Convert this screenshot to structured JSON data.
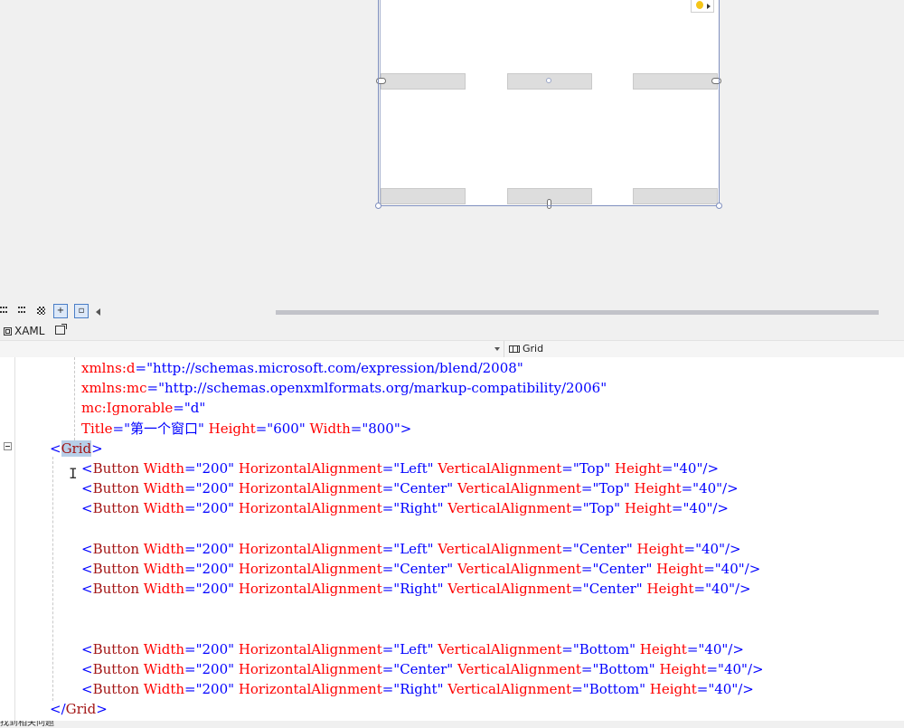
{
  "designer": {
    "bulb_icon": "lightbulb-icon"
  },
  "toolstrip": {
    "icons": [
      "grid-layout-icon",
      "snap-grid-icon",
      "checker-icon",
      "snap-lines-icon",
      "project-code-icon",
      "scroll-left-icon"
    ]
  },
  "tabs": {
    "xaml_label": "XAML"
  },
  "navbar": {
    "element_label": "Grid"
  },
  "editor": {
    "lines": [
      {
        "row": 0,
        "indent": 90,
        "parts": [
          {
            "t": "xmlns:d",
            "c": "att"
          },
          {
            "t": "=\"",
            "c": "br"
          },
          {
            "t": "http://schemas.microsoft.com/expression/blend/2008",
            "c": "val"
          },
          {
            "t": "\"",
            "c": "br"
          }
        ]
      },
      {
        "row": 1,
        "indent": 90,
        "parts": [
          {
            "t": "xmlns:mc",
            "c": "att"
          },
          {
            "t": "=\"",
            "c": "br"
          },
          {
            "t": "http://schemas.openxmlformats.org/markup-compatibility/2006",
            "c": "val"
          },
          {
            "t": "\"",
            "c": "br"
          }
        ]
      },
      {
        "row": 2,
        "indent": 90,
        "parts": [
          {
            "t": "mc:Ignorable",
            "c": "att"
          },
          {
            "t": "=\"",
            "c": "br"
          },
          {
            "t": "d",
            "c": "val"
          },
          {
            "t": "\"",
            "c": "br"
          }
        ]
      },
      {
        "row": 3,
        "indent": 90,
        "parts": [
          {
            "t": "Title",
            "c": "att"
          },
          {
            "t": "=\"",
            "c": "br"
          },
          {
            "t": "第一个窗口",
            "c": "val"
          },
          {
            "t": "\" ",
            "c": "br"
          },
          {
            "t": "Height",
            "c": "att"
          },
          {
            "t": "=\"",
            "c": "br"
          },
          {
            "t": "600",
            "c": "val"
          },
          {
            "t": "\" ",
            "c": "br"
          },
          {
            "t": "Width",
            "c": "att"
          },
          {
            "t": "=\"",
            "c": "br"
          },
          {
            "t": "800",
            "c": "val"
          },
          {
            "t": "\">",
            "c": "br"
          }
        ]
      },
      {
        "row": 4,
        "indent": 55,
        "parts": [
          {
            "t": "<",
            "c": "br"
          },
          {
            "t": "Grid",
            "c": "tag sel"
          },
          {
            "t": ">",
            "c": "br"
          }
        ]
      },
      {
        "row": 5,
        "indent": 90,
        "parts": [
          {
            "t": "<",
            "c": "br"
          },
          {
            "t": "Button",
            "c": "tag"
          },
          {
            "t": " Width",
            "c": "att"
          },
          {
            "t": "=\"",
            "c": "br"
          },
          {
            "t": "200",
            "c": "val"
          },
          {
            "t": "\" ",
            "c": "br"
          },
          {
            "t": "HorizontalAlignment",
            "c": "att"
          },
          {
            "t": "=\"",
            "c": "br"
          },
          {
            "t": "Left",
            "c": "val"
          },
          {
            "t": "\" ",
            "c": "br"
          },
          {
            "t": "VerticalAlignment",
            "c": "att"
          },
          {
            "t": "=\"",
            "c": "br"
          },
          {
            "t": "Top",
            "c": "val"
          },
          {
            "t": "\" ",
            "c": "br"
          },
          {
            "t": "Height",
            "c": "att"
          },
          {
            "t": "=\"",
            "c": "br"
          },
          {
            "t": "40",
            "c": "val"
          },
          {
            "t": "\"/>",
            "c": "br"
          }
        ]
      },
      {
        "row": 6,
        "indent": 90,
        "parts": [
          {
            "t": "<",
            "c": "br"
          },
          {
            "t": "Button",
            "c": "tag"
          },
          {
            "t": " Width",
            "c": "att"
          },
          {
            "t": "=\"",
            "c": "br"
          },
          {
            "t": "200",
            "c": "val"
          },
          {
            "t": "\" ",
            "c": "br"
          },
          {
            "t": "HorizontalAlignment",
            "c": "att"
          },
          {
            "t": "=\"",
            "c": "br"
          },
          {
            "t": "Center",
            "c": "val"
          },
          {
            "t": "\" ",
            "c": "br"
          },
          {
            "t": "VerticalAlignment",
            "c": "att"
          },
          {
            "t": "=\"",
            "c": "br"
          },
          {
            "t": "Top",
            "c": "val"
          },
          {
            "t": "\" ",
            "c": "br"
          },
          {
            "t": "Height",
            "c": "att"
          },
          {
            "t": "=\"",
            "c": "br"
          },
          {
            "t": "40",
            "c": "val"
          },
          {
            "t": "\"/>",
            "c": "br"
          }
        ]
      },
      {
        "row": 7,
        "indent": 90,
        "parts": [
          {
            "t": "<",
            "c": "br"
          },
          {
            "t": "Button",
            "c": "tag"
          },
          {
            "t": " Width",
            "c": "att"
          },
          {
            "t": "=\"",
            "c": "br"
          },
          {
            "t": "200",
            "c": "val"
          },
          {
            "t": "\" ",
            "c": "br"
          },
          {
            "t": "HorizontalAlignment",
            "c": "att"
          },
          {
            "t": "=\"",
            "c": "br"
          },
          {
            "t": "Right",
            "c": "val"
          },
          {
            "t": "\" ",
            "c": "br"
          },
          {
            "t": "VerticalAlignment",
            "c": "att"
          },
          {
            "t": "=\"",
            "c": "br"
          },
          {
            "t": "Top",
            "c": "val"
          },
          {
            "t": "\" ",
            "c": "br"
          },
          {
            "t": "Height",
            "c": "att"
          },
          {
            "t": "=\"",
            "c": "br"
          },
          {
            "t": "40",
            "c": "val"
          },
          {
            "t": "\"/>",
            "c": "br"
          }
        ]
      },
      {
        "row": 9,
        "indent": 90,
        "parts": [
          {
            "t": "<",
            "c": "br"
          },
          {
            "t": "Button",
            "c": "tag"
          },
          {
            "t": " Width",
            "c": "att"
          },
          {
            "t": "=\"",
            "c": "br"
          },
          {
            "t": "200",
            "c": "val"
          },
          {
            "t": "\" ",
            "c": "br"
          },
          {
            "t": "HorizontalAlignment",
            "c": "att"
          },
          {
            "t": "=\"",
            "c": "br"
          },
          {
            "t": "Left",
            "c": "val"
          },
          {
            "t": "\" ",
            "c": "br"
          },
          {
            "t": "VerticalAlignment",
            "c": "att"
          },
          {
            "t": "=\"",
            "c": "br"
          },
          {
            "t": "Center",
            "c": "val"
          },
          {
            "t": "\" ",
            "c": "br"
          },
          {
            "t": "Height",
            "c": "att"
          },
          {
            "t": "=\"",
            "c": "br"
          },
          {
            "t": "40",
            "c": "val"
          },
          {
            "t": "\"/>",
            "c": "br"
          }
        ]
      },
      {
        "row": 10,
        "indent": 90,
        "parts": [
          {
            "t": "<",
            "c": "br"
          },
          {
            "t": "Button",
            "c": "tag"
          },
          {
            "t": " Width",
            "c": "att"
          },
          {
            "t": "=\"",
            "c": "br"
          },
          {
            "t": "200",
            "c": "val"
          },
          {
            "t": "\" ",
            "c": "br"
          },
          {
            "t": "HorizontalAlignment",
            "c": "att"
          },
          {
            "t": "=\"",
            "c": "br"
          },
          {
            "t": "Center",
            "c": "val"
          },
          {
            "t": "\" ",
            "c": "br"
          },
          {
            "t": "VerticalAlignment",
            "c": "att"
          },
          {
            "t": "=\"",
            "c": "br"
          },
          {
            "t": "Center",
            "c": "val"
          },
          {
            "t": "\" ",
            "c": "br"
          },
          {
            "t": "Height",
            "c": "att"
          },
          {
            "t": "=\"",
            "c": "br"
          },
          {
            "t": "40",
            "c": "val"
          },
          {
            "t": "\"/>",
            "c": "br"
          }
        ]
      },
      {
        "row": 11,
        "indent": 90,
        "parts": [
          {
            "t": "<",
            "c": "br"
          },
          {
            "t": "Button",
            "c": "tag"
          },
          {
            "t": " Width",
            "c": "att"
          },
          {
            "t": "=\"",
            "c": "br"
          },
          {
            "t": "200",
            "c": "val"
          },
          {
            "t": "\" ",
            "c": "br"
          },
          {
            "t": "HorizontalAlignment",
            "c": "att"
          },
          {
            "t": "=\"",
            "c": "br"
          },
          {
            "t": "Right",
            "c": "val"
          },
          {
            "t": "\" ",
            "c": "br"
          },
          {
            "t": "VerticalAlignment",
            "c": "att"
          },
          {
            "t": "=\"",
            "c": "br"
          },
          {
            "t": "Center",
            "c": "val"
          },
          {
            "t": "\" ",
            "c": "br"
          },
          {
            "t": "Height",
            "c": "att"
          },
          {
            "t": "=\"",
            "c": "br"
          },
          {
            "t": "40",
            "c": "val"
          },
          {
            "t": "\"/>",
            "c": "br"
          }
        ]
      },
      {
        "row": 14,
        "indent": 90,
        "parts": [
          {
            "t": "<",
            "c": "br"
          },
          {
            "t": "Button",
            "c": "tag"
          },
          {
            "t": " Width",
            "c": "att"
          },
          {
            "t": "=\"",
            "c": "br"
          },
          {
            "t": "200",
            "c": "val"
          },
          {
            "t": "\" ",
            "c": "br"
          },
          {
            "t": "HorizontalAlignment",
            "c": "att"
          },
          {
            "t": "=\"",
            "c": "br"
          },
          {
            "t": "Left",
            "c": "val"
          },
          {
            "t": "\" ",
            "c": "br"
          },
          {
            "t": "VerticalAlignment",
            "c": "att"
          },
          {
            "t": "=\"",
            "c": "br"
          },
          {
            "t": "Bottom",
            "c": "val"
          },
          {
            "t": "\" ",
            "c": "br"
          },
          {
            "t": "Height",
            "c": "att"
          },
          {
            "t": "=\"",
            "c": "br"
          },
          {
            "t": "40",
            "c": "val"
          },
          {
            "t": "\"/>",
            "c": "br"
          }
        ]
      },
      {
        "row": 15,
        "indent": 90,
        "parts": [
          {
            "t": "<",
            "c": "br"
          },
          {
            "t": "Button",
            "c": "tag"
          },
          {
            "t": " Width",
            "c": "att"
          },
          {
            "t": "=\"",
            "c": "br"
          },
          {
            "t": "200",
            "c": "val"
          },
          {
            "t": "\" ",
            "c": "br"
          },
          {
            "t": "HorizontalAlignment",
            "c": "att"
          },
          {
            "t": "=\"",
            "c": "br"
          },
          {
            "t": "Center",
            "c": "val"
          },
          {
            "t": "\" ",
            "c": "br"
          },
          {
            "t": "VerticalAlignment",
            "c": "att"
          },
          {
            "t": "=\"",
            "c": "br"
          },
          {
            "t": "Bottom",
            "c": "val"
          },
          {
            "t": "\" ",
            "c": "br"
          },
          {
            "t": "Height",
            "c": "att"
          },
          {
            "t": "=\"",
            "c": "br"
          },
          {
            "t": "40",
            "c": "val"
          },
          {
            "t": "\"/>",
            "c": "br"
          }
        ]
      },
      {
        "row": 16,
        "indent": 90,
        "parts": [
          {
            "t": "<",
            "c": "br"
          },
          {
            "t": "Button",
            "c": "tag"
          },
          {
            "t": " Width",
            "c": "att"
          },
          {
            "t": "=\"",
            "c": "br"
          },
          {
            "t": "200",
            "c": "val"
          },
          {
            "t": "\" ",
            "c": "br"
          },
          {
            "t": "HorizontalAlignment",
            "c": "att"
          },
          {
            "t": "=\"",
            "c": "br"
          },
          {
            "t": "Right",
            "c": "val"
          },
          {
            "t": "\" ",
            "c": "br"
          },
          {
            "t": "VerticalAlignment",
            "c": "att"
          },
          {
            "t": "=\"",
            "c": "br"
          },
          {
            "t": "Bottom",
            "c": "val"
          },
          {
            "t": "\" ",
            "c": "br"
          },
          {
            "t": "Height",
            "c": "att"
          },
          {
            "t": "=\"",
            "c": "br"
          },
          {
            "t": "40",
            "c": "val"
          },
          {
            "t": "\"/>",
            "c": "br"
          }
        ]
      },
      {
        "row": 17,
        "indent": 55,
        "parts": [
          {
            "t": "</",
            "c": "br"
          },
          {
            "t": "Grid",
            "c": "tag"
          },
          {
            "t": ">",
            "c": "br"
          }
        ]
      }
    ]
  },
  "status": {
    "text": "找到相关问题"
  }
}
